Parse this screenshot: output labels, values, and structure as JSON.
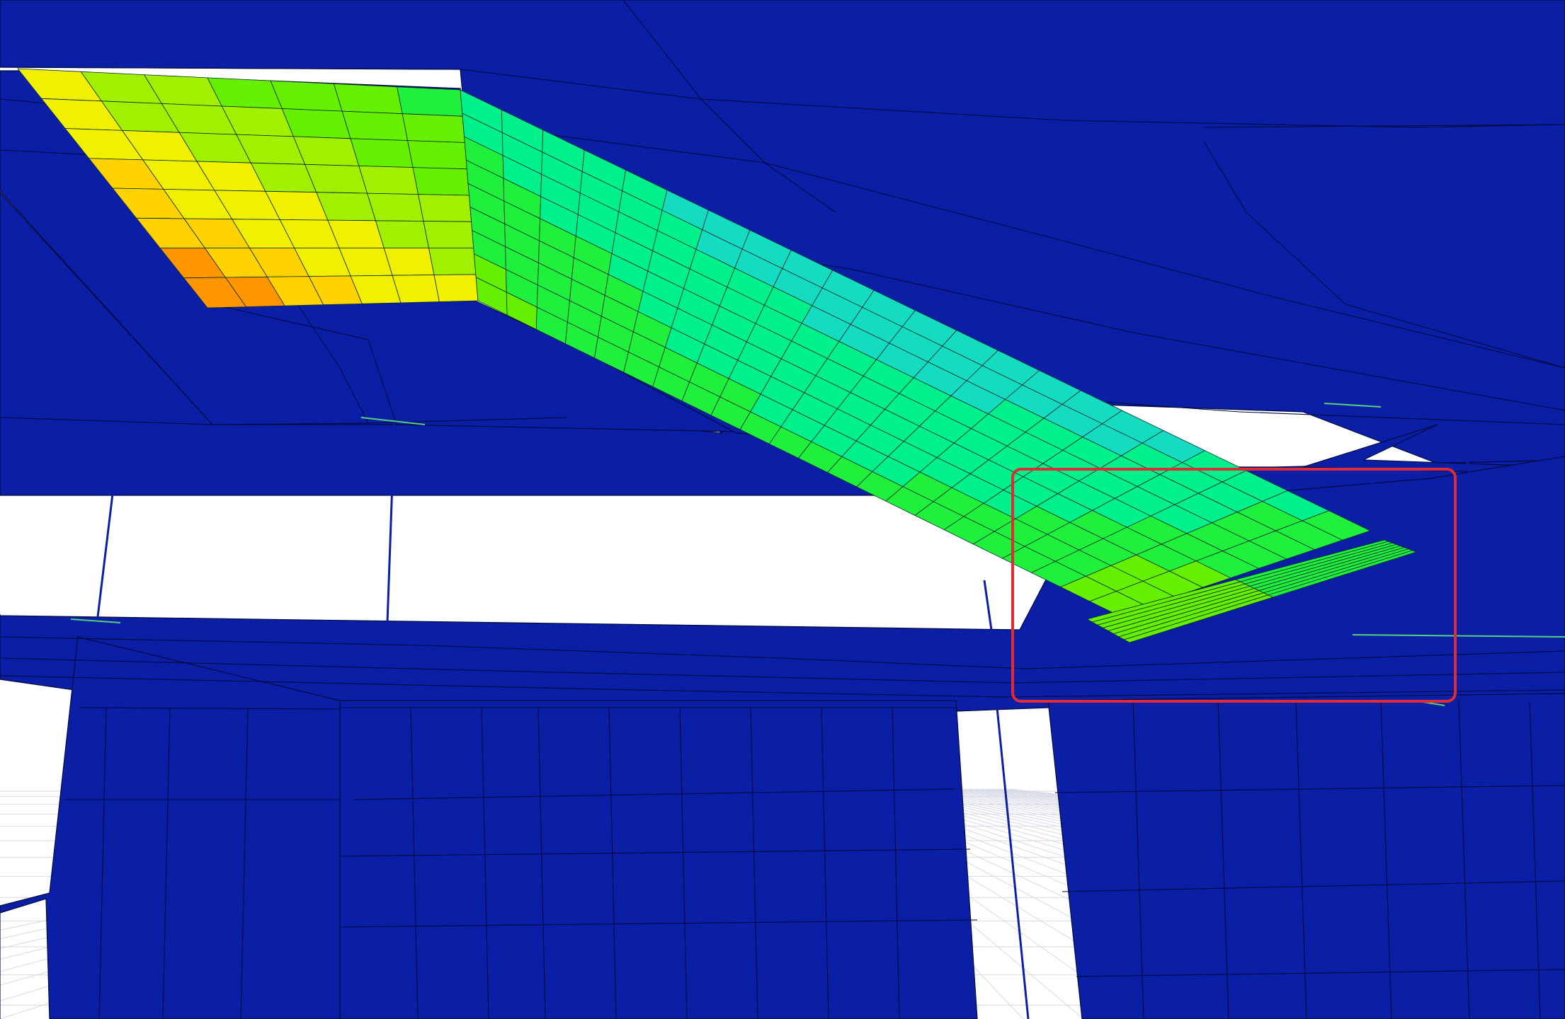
{
  "colors": {
    "background": "#ffffff",
    "structure": "#0b1fa6",
    "mesh_line": "#000a3c",
    "floor_grid": "#d7dae6",
    "highlight_box": "#e02b35",
    "contour_scale": [
      "#0b1fa6",
      "#00c8ff",
      "#14dcc0",
      "#00f08c",
      "#1ef03c",
      "#64f000",
      "#a0f000",
      "#f0f000",
      "#ffd200",
      "#ff9600"
    ]
  },
  "scene": {
    "view": "3d-fea-stress-contour",
    "elements": [
      "inclined-stair-slab",
      "landing-slab",
      "lower-flight-strip",
      "floor-slabs",
      "columns",
      "walls"
    ],
    "highlight": "stair-joint-region"
  }
}
